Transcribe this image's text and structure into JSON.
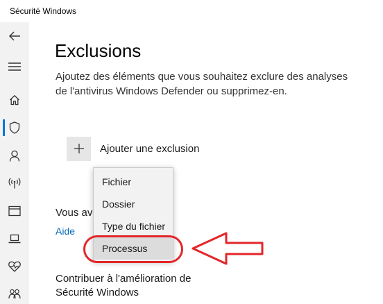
{
  "window": {
    "title": "Sécurité Windows"
  },
  "sidebar": {
    "icons": [
      "back-arrow-icon",
      "hamburger-menu-icon",
      "home-icon",
      "shield-icon",
      "person-icon",
      "wireless-icon",
      "browser-window-icon",
      "laptop-icon",
      "heart-pulse-icon",
      "family-icon"
    ],
    "active": "shield-icon"
  },
  "main": {
    "title": "Exclusions",
    "description": "Ajoutez des éléments que vous souhaitez exclure des analyses de l'antivirus Windows Defender ou supprimez-en.",
    "add_exclusion_label": "Ajouter une exclusion",
    "partial_text": "Vous ave",
    "help_link": "Aide",
    "contribute_text": "Contribuer à l'amélioration de Sécurité Windows"
  },
  "dropdown": {
    "items": [
      "Fichier",
      "Dossier",
      "Type du fichier",
      "Processus"
    ],
    "highlighted": "Processus"
  },
  "colors": {
    "accent": "#0078d4",
    "link": "#0067b8",
    "annotation": "#e3262a",
    "sidebar_bg": "#f2f2f2"
  }
}
